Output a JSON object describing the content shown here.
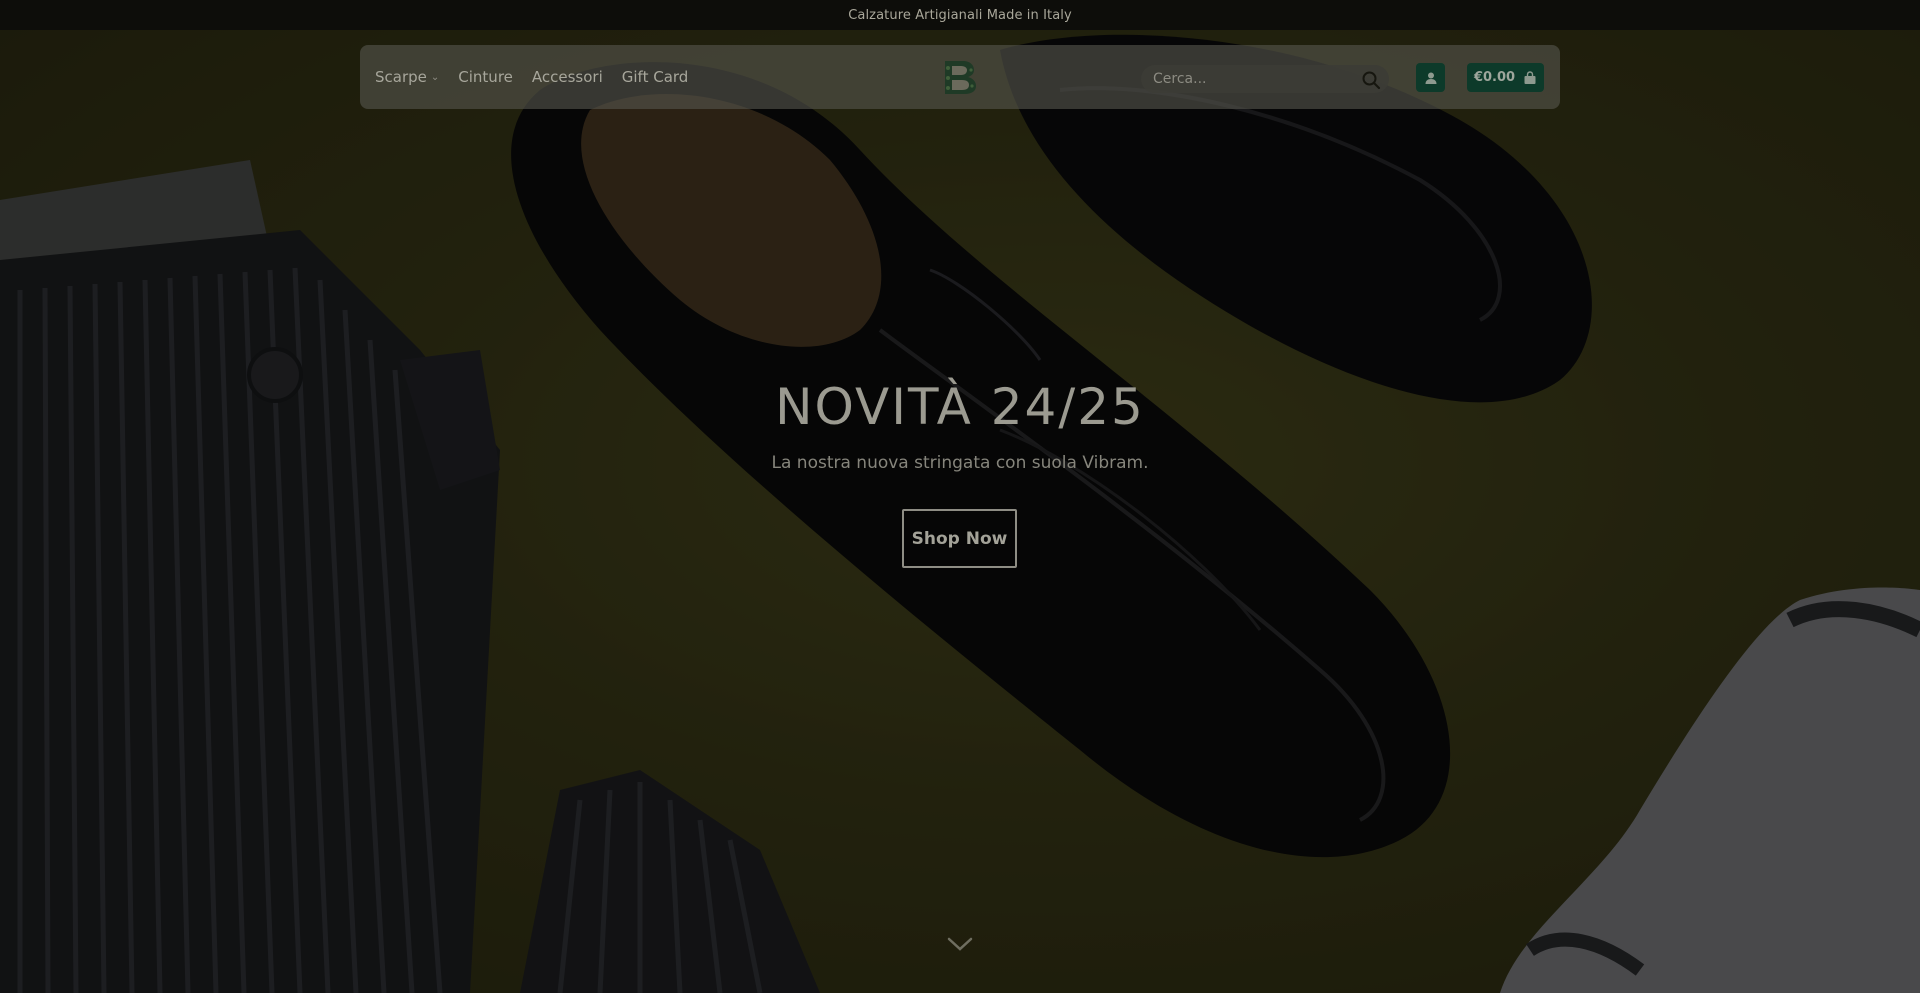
{
  "announcement": "Calzature Artigianali Made in Italy",
  "nav": {
    "items": [
      {
        "label": "Scarpe",
        "has_dropdown": true
      },
      {
        "label": "Cinture",
        "has_dropdown": false
      },
      {
        "label": "Accessori",
        "has_dropdown": false
      },
      {
        "label": "Gift Card",
        "has_dropdown": false
      }
    ]
  },
  "search": {
    "placeholder": "Cerca..."
  },
  "cart": {
    "total": "€0.00"
  },
  "hero": {
    "title": "NOVITÀ 24/25",
    "subtitle": "La nostra nuova stringata con suola Vibram.",
    "cta_label": "Shop Now"
  },
  "colors": {
    "brand_green": "#0d3a2a",
    "topbar_bg": "#0d0d0a",
    "hero_bg": "#3b3a18"
  },
  "icons": {
    "search": "search-icon",
    "account": "user-icon",
    "cart": "shopping-bag-icon",
    "scroll": "chevron-down-icon",
    "dropdown": "chevron-down-icon"
  }
}
